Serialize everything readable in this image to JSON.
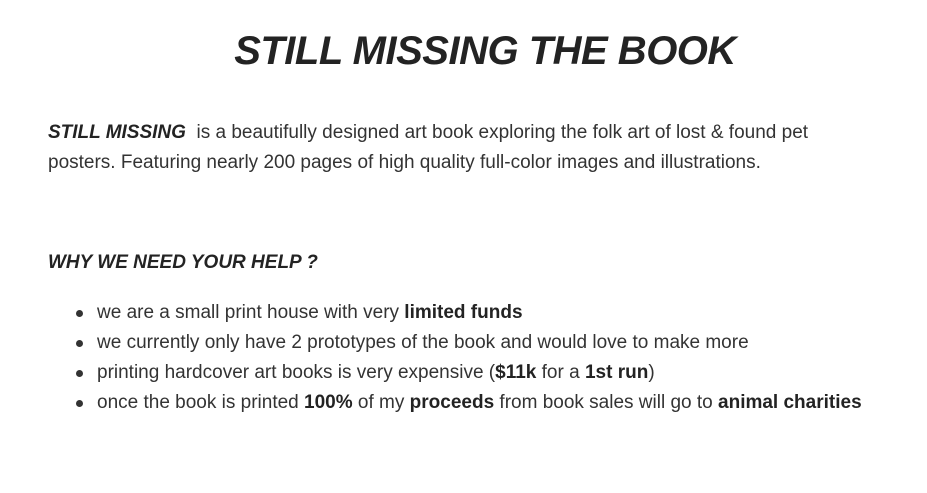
{
  "title": "STILL MISSING THE BOOK",
  "intro": {
    "book_name": "STILL MISSING",
    "line1_rest": "is a beautifully designed art book exploring the folk art of lost & found pet",
    "line2": "posters.  Featuring nearly 200 pages of high quality full-color images and illustrations."
  },
  "help_heading": "WHY WE NEED YOUR HELP ?",
  "reasons": [
    {
      "t1": "we are a small print house with very ",
      "b1": "limited funds"
    },
    {
      "t1": "we currently only have 2 prototypes of the book and would love to make more"
    },
    {
      "t1": "printing hardcover art books is very expensive (",
      "b1": "$11k",
      "t2": " for a ",
      "b2": "1st run",
      "t3": ")"
    },
    {
      "t1": "once the book is printed  ",
      "b1": "100%",
      "t2": " of my ",
      "b2": "proceeds",
      "t3": " from book sales will go to ",
      "b3": "animal charities"
    }
  ]
}
